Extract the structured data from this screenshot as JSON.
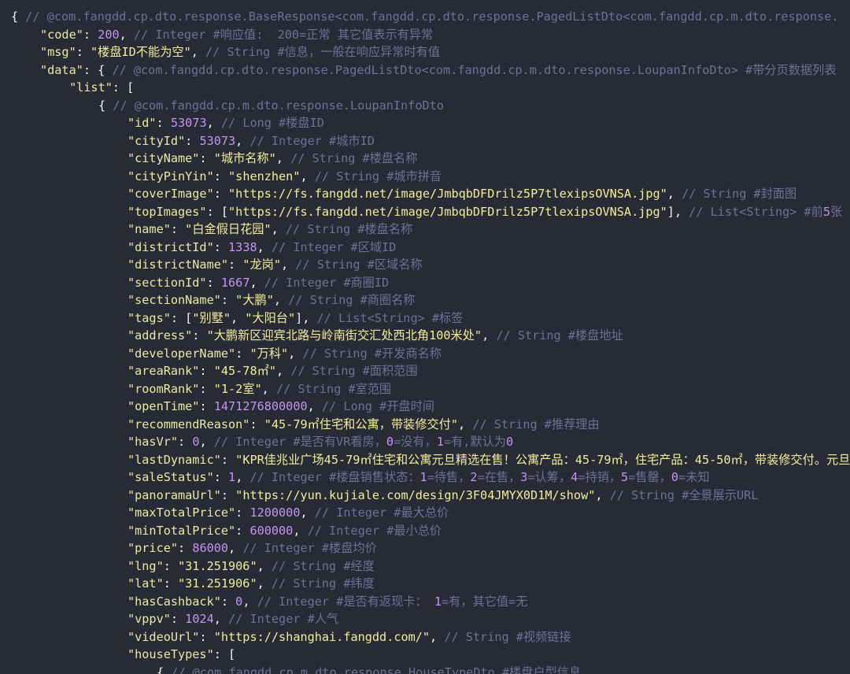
{
  "colors": {
    "background": "#282a36",
    "text": "#f8f8f2",
    "comment": "#6b7394",
    "key": "#e9eba3",
    "string": "#f1ee99",
    "number": "#c495f2"
  },
  "lines": [
    {
      "indent": 0,
      "tokens": [
        {
          "t": "white",
          "v": "{ "
        },
        {
          "t": "comment",
          "v": "// @com.fangdd.cp.dto.response.BaseResponse<com.fangdd.cp.dto.response.PagedListDto<com.fangdd.cp.m.dto.response."
        }
      ]
    },
    {
      "indent": 1,
      "tokens": [
        {
          "t": "key",
          "v": "\"code\""
        },
        {
          "t": "white",
          "v": ": "
        },
        {
          "t": "number",
          "v": "200"
        },
        {
          "t": "white",
          "v": ", "
        },
        {
          "t": "comment",
          "v": "// Integer #响应值:  200=正常 其它值表示有异常"
        }
      ]
    },
    {
      "indent": 1,
      "tokens": [
        {
          "t": "key",
          "v": "\"msg\""
        },
        {
          "t": "white",
          "v": ": "
        },
        {
          "t": "string",
          "v": "\"楼盘ID不能为空\""
        },
        {
          "t": "white",
          "v": ", "
        },
        {
          "t": "comment",
          "v": "// String #信息，一般在响应异常时有值"
        }
      ]
    },
    {
      "indent": 1,
      "tokens": [
        {
          "t": "key",
          "v": "\"data\""
        },
        {
          "t": "white",
          "v": ": { "
        },
        {
          "t": "comment",
          "v": "// @com.fangdd.cp.dto.response.PagedListDto<com.fangdd.cp.m.dto.response.LoupanInfoDto> #带分页数据列表"
        }
      ]
    },
    {
      "indent": 2,
      "tokens": [
        {
          "t": "key",
          "v": "\"list\""
        },
        {
          "t": "white",
          "v": ": ["
        }
      ]
    },
    {
      "indent": 3,
      "tokens": [
        {
          "t": "white",
          "v": "{ "
        },
        {
          "t": "comment",
          "v": "// @com.fangdd.cp.m.dto.response.LoupanInfoDto"
        }
      ]
    },
    {
      "indent": 4,
      "tokens": [
        {
          "t": "key",
          "v": "\"id\""
        },
        {
          "t": "white",
          "v": ": "
        },
        {
          "t": "number",
          "v": "53073"
        },
        {
          "t": "white",
          "v": ", "
        },
        {
          "t": "comment",
          "v": "// Long #楼盘ID"
        }
      ]
    },
    {
      "indent": 4,
      "tokens": [
        {
          "t": "key",
          "v": "\"cityId\""
        },
        {
          "t": "white",
          "v": ": "
        },
        {
          "t": "number",
          "v": "53073"
        },
        {
          "t": "white",
          "v": ", "
        },
        {
          "t": "comment",
          "v": "// Integer #城市ID"
        }
      ]
    },
    {
      "indent": 4,
      "tokens": [
        {
          "t": "key",
          "v": "\"cityName\""
        },
        {
          "t": "white",
          "v": ": "
        },
        {
          "t": "string",
          "v": "\"城市名称\""
        },
        {
          "t": "white",
          "v": ", "
        },
        {
          "t": "comment",
          "v": "// String #楼盘名称"
        }
      ]
    },
    {
      "indent": 4,
      "tokens": [
        {
          "t": "key",
          "v": "\"cityPinYin\""
        },
        {
          "t": "white",
          "v": ": "
        },
        {
          "t": "string",
          "v": "\"shenzhen\""
        },
        {
          "t": "white",
          "v": ", "
        },
        {
          "t": "comment",
          "v": "// String #城市拼音"
        }
      ]
    },
    {
      "indent": 4,
      "tokens": [
        {
          "t": "key",
          "v": "\"coverImage\""
        },
        {
          "t": "white",
          "v": ": "
        },
        {
          "t": "string",
          "v": "\"https://fs.fangdd.net/image/JmbqbDFDrilz5P7tlexipsOVNSA.jpg\""
        },
        {
          "t": "white",
          "v": ", "
        },
        {
          "t": "comment",
          "v": "// String #封面图"
        }
      ]
    },
    {
      "indent": 4,
      "tokens": [
        {
          "t": "key",
          "v": "\"topImages\""
        },
        {
          "t": "white",
          "v": ": ["
        },
        {
          "t": "string",
          "v": "\"https://fs.fangdd.net/image/JmbqbDFDrilz5P7tlexipsOVNSA.jpg\""
        },
        {
          "t": "white",
          "v": "], "
        },
        {
          "t": "comment",
          "v": "// List<String> #前"
        },
        {
          "t": "number",
          "v": "5"
        },
        {
          "t": "comment",
          "v": "张"
        }
      ]
    },
    {
      "indent": 4,
      "tokens": [
        {
          "t": "key",
          "v": "\"name\""
        },
        {
          "t": "white",
          "v": ": "
        },
        {
          "t": "string",
          "v": "\"白金假日花园\""
        },
        {
          "t": "white",
          "v": ", "
        },
        {
          "t": "comment",
          "v": "// String #楼盘名称"
        }
      ]
    },
    {
      "indent": 4,
      "tokens": [
        {
          "t": "key",
          "v": "\"districtId\""
        },
        {
          "t": "white",
          "v": ": "
        },
        {
          "t": "number",
          "v": "1338"
        },
        {
          "t": "white",
          "v": ", "
        },
        {
          "t": "comment",
          "v": "// Integer #区域ID"
        }
      ]
    },
    {
      "indent": 4,
      "tokens": [
        {
          "t": "key",
          "v": "\"districtName\""
        },
        {
          "t": "white",
          "v": ": "
        },
        {
          "t": "string",
          "v": "\"龙岗\""
        },
        {
          "t": "white",
          "v": ", "
        },
        {
          "t": "comment",
          "v": "// String #区域名称"
        }
      ]
    },
    {
      "indent": 4,
      "tokens": [
        {
          "t": "key",
          "v": "\"sectionId\""
        },
        {
          "t": "white",
          "v": ": "
        },
        {
          "t": "number",
          "v": "1667"
        },
        {
          "t": "white",
          "v": ", "
        },
        {
          "t": "comment",
          "v": "// Integer #商圈ID"
        }
      ]
    },
    {
      "indent": 4,
      "tokens": [
        {
          "t": "key",
          "v": "\"sectionName\""
        },
        {
          "t": "white",
          "v": ": "
        },
        {
          "t": "string",
          "v": "\"大鹏\""
        },
        {
          "t": "white",
          "v": ", "
        },
        {
          "t": "comment",
          "v": "// String #商圈名称"
        }
      ]
    },
    {
      "indent": 4,
      "tokens": [
        {
          "t": "key",
          "v": "\"tags\""
        },
        {
          "t": "white",
          "v": ": ["
        },
        {
          "t": "string",
          "v": "\"别墅\""
        },
        {
          "t": "white",
          "v": ", "
        },
        {
          "t": "string",
          "v": "\"大阳台\""
        },
        {
          "t": "white",
          "v": "], "
        },
        {
          "t": "comment",
          "v": "// List<String> #标签"
        }
      ]
    },
    {
      "indent": 4,
      "tokens": [
        {
          "t": "key",
          "v": "\"address\""
        },
        {
          "t": "white",
          "v": ": "
        },
        {
          "t": "string",
          "v": "\"大鹏新区迎宾北路与岭南街交汇处西北角100米处\""
        },
        {
          "t": "white",
          "v": ", "
        },
        {
          "t": "comment",
          "v": "// String #楼盘地址"
        }
      ]
    },
    {
      "indent": 4,
      "tokens": [
        {
          "t": "key",
          "v": "\"developerName\""
        },
        {
          "t": "white",
          "v": ": "
        },
        {
          "t": "string",
          "v": "\"万科\""
        },
        {
          "t": "white",
          "v": ", "
        },
        {
          "t": "comment",
          "v": "// String #开发商名称"
        }
      ]
    },
    {
      "indent": 4,
      "tokens": [
        {
          "t": "key",
          "v": "\"areaRank\""
        },
        {
          "t": "white",
          "v": ": "
        },
        {
          "t": "string",
          "v": "\"45-78㎡\""
        },
        {
          "t": "white",
          "v": ", "
        },
        {
          "t": "comment",
          "v": "// String #面积范围"
        }
      ]
    },
    {
      "indent": 4,
      "tokens": [
        {
          "t": "key",
          "v": "\"roomRank\""
        },
        {
          "t": "white",
          "v": ": "
        },
        {
          "t": "string",
          "v": "\"1-2室\""
        },
        {
          "t": "white",
          "v": ", "
        },
        {
          "t": "comment",
          "v": "// String #室范围"
        }
      ]
    },
    {
      "indent": 4,
      "tokens": [
        {
          "t": "key",
          "v": "\"openTime\""
        },
        {
          "t": "white",
          "v": ": "
        },
        {
          "t": "number",
          "v": "1471276800000"
        },
        {
          "t": "white",
          "v": ", "
        },
        {
          "t": "comment",
          "v": "// Long #开盘时间"
        }
      ]
    },
    {
      "indent": 4,
      "tokens": [
        {
          "t": "key",
          "v": "\"recommendReason\""
        },
        {
          "t": "white",
          "v": ": "
        },
        {
          "t": "string",
          "v": "\"45-79㎡住宅和公寓，带装修交付\""
        },
        {
          "t": "white",
          "v": ", "
        },
        {
          "t": "comment",
          "v": "// String #推荐理由"
        }
      ]
    },
    {
      "indent": 4,
      "tokens": [
        {
          "t": "key",
          "v": "\"hasVr\""
        },
        {
          "t": "white",
          "v": ": "
        },
        {
          "t": "number",
          "v": "0"
        },
        {
          "t": "white",
          "v": ", "
        },
        {
          "t": "comment",
          "v": "// Integer #是否有VR看房，"
        },
        {
          "t": "number",
          "v": "0"
        },
        {
          "t": "comment",
          "v": "=没有，"
        },
        {
          "t": "number",
          "v": "1"
        },
        {
          "t": "comment",
          "v": "=有,默认为"
        },
        {
          "t": "number",
          "v": "0"
        }
      ]
    },
    {
      "indent": 4,
      "tokens": [
        {
          "t": "key",
          "v": "\"lastDynamic\""
        },
        {
          "t": "white",
          "v": ": "
        },
        {
          "t": "string",
          "v": "\"KPR佳兆业广场45-79㎡住宅和公寓元旦精选在售！公寓产品：45-79㎡，住宅产品：45-50㎡，带装修交付。元旦"
        }
      ]
    },
    {
      "indent": 4,
      "tokens": [
        {
          "t": "key",
          "v": "\"saleStatus\""
        },
        {
          "t": "white",
          "v": ": "
        },
        {
          "t": "number",
          "v": "1"
        },
        {
          "t": "white",
          "v": ", "
        },
        {
          "t": "comment",
          "v": "// Integer #楼盘销售状态："
        },
        {
          "t": "number",
          "v": "1"
        },
        {
          "t": "comment",
          "v": "=待售，"
        },
        {
          "t": "number",
          "v": "2"
        },
        {
          "t": "comment",
          "v": "=在售，"
        },
        {
          "t": "number",
          "v": "3"
        },
        {
          "t": "comment",
          "v": "=认筹，"
        },
        {
          "t": "number",
          "v": "4"
        },
        {
          "t": "comment",
          "v": "=持销，"
        },
        {
          "t": "number",
          "v": "5"
        },
        {
          "t": "comment",
          "v": "=售罄，"
        },
        {
          "t": "number",
          "v": "0"
        },
        {
          "t": "comment",
          "v": "=未知"
        }
      ]
    },
    {
      "indent": 4,
      "tokens": [
        {
          "t": "key",
          "v": "\"panoramaUrl\""
        },
        {
          "t": "white",
          "v": ": "
        },
        {
          "t": "string",
          "v": "\"https://yun.kujiale.com/design/3F04JMYX0D1M/show\""
        },
        {
          "t": "white",
          "v": ", "
        },
        {
          "t": "comment",
          "v": "// String #全景展示URL"
        }
      ]
    },
    {
      "indent": 4,
      "tokens": [
        {
          "t": "key",
          "v": "\"maxTotalPrice\""
        },
        {
          "t": "white",
          "v": ": "
        },
        {
          "t": "number",
          "v": "1200000"
        },
        {
          "t": "white",
          "v": ", "
        },
        {
          "t": "comment",
          "v": "// Integer #最大总价"
        }
      ]
    },
    {
      "indent": 4,
      "tokens": [
        {
          "t": "key",
          "v": "\"minTotalPrice\""
        },
        {
          "t": "white",
          "v": ": "
        },
        {
          "t": "number",
          "v": "600000"
        },
        {
          "t": "white",
          "v": ", "
        },
        {
          "t": "comment",
          "v": "// Integer #最小总价"
        }
      ]
    },
    {
      "indent": 4,
      "tokens": [
        {
          "t": "key",
          "v": "\"price\""
        },
        {
          "t": "white",
          "v": ": "
        },
        {
          "t": "number",
          "v": "86000"
        },
        {
          "t": "white",
          "v": ", "
        },
        {
          "t": "comment",
          "v": "// Integer #楼盘均价"
        }
      ]
    },
    {
      "indent": 4,
      "tokens": [
        {
          "t": "key",
          "v": "\"lng\""
        },
        {
          "t": "white",
          "v": ": "
        },
        {
          "t": "string",
          "v": "\"31.251906\""
        },
        {
          "t": "white",
          "v": ", "
        },
        {
          "t": "comment",
          "v": "// String #经度"
        }
      ]
    },
    {
      "indent": 4,
      "tokens": [
        {
          "t": "key",
          "v": "\"lat\""
        },
        {
          "t": "white",
          "v": ": "
        },
        {
          "t": "string",
          "v": "\"31.251906\""
        },
        {
          "t": "white",
          "v": ", "
        },
        {
          "t": "comment",
          "v": "// String #纬度"
        }
      ]
    },
    {
      "indent": 4,
      "tokens": [
        {
          "t": "key",
          "v": "\"hasCashback\""
        },
        {
          "t": "white",
          "v": ": "
        },
        {
          "t": "number",
          "v": "0"
        },
        {
          "t": "white",
          "v": ", "
        },
        {
          "t": "comment",
          "v": "// Integer #是否有返现卡： "
        },
        {
          "t": "number",
          "v": "1"
        },
        {
          "t": "comment",
          "v": "=有，其它值=无"
        }
      ]
    },
    {
      "indent": 4,
      "tokens": [
        {
          "t": "key",
          "v": "\"vppv\""
        },
        {
          "t": "white",
          "v": ": "
        },
        {
          "t": "number",
          "v": "1024"
        },
        {
          "t": "white",
          "v": ", "
        },
        {
          "t": "comment",
          "v": "// Integer #人气"
        }
      ]
    },
    {
      "indent": 4,
      "tokens": [
        {
          "t": "key",
          "v": "\"videoUrl\""
        },
        {
          "t": "white",
          "v": ": "
        },
        {
          "t": "string",
          "v": "\"https://shanghai.fangdd.com/\""
        },
        {
          "t": "white",
          "v": ", "
        },
        {
          "t": "comment",
          "v": "// String #视频链接"
        }
      ]
    },
    {
      "indent": 4,
      "tokens": [
        {
          "t": "key",
          "v": "\"houseTypes\""
        },
        {
          "t": "white",
          "v": ": ["
        }
      ]
    },
    {
      "indent": 5,
      "tokens": [
        {
          "t": "white",
          "v": "{ "
        },
        {
          "t": "comment",
          "v": "// @com.fangdd.cp.m.dto.response.HouseTypeDto #楼盘户型信息"
        }
      ]
    }
  ]
}
